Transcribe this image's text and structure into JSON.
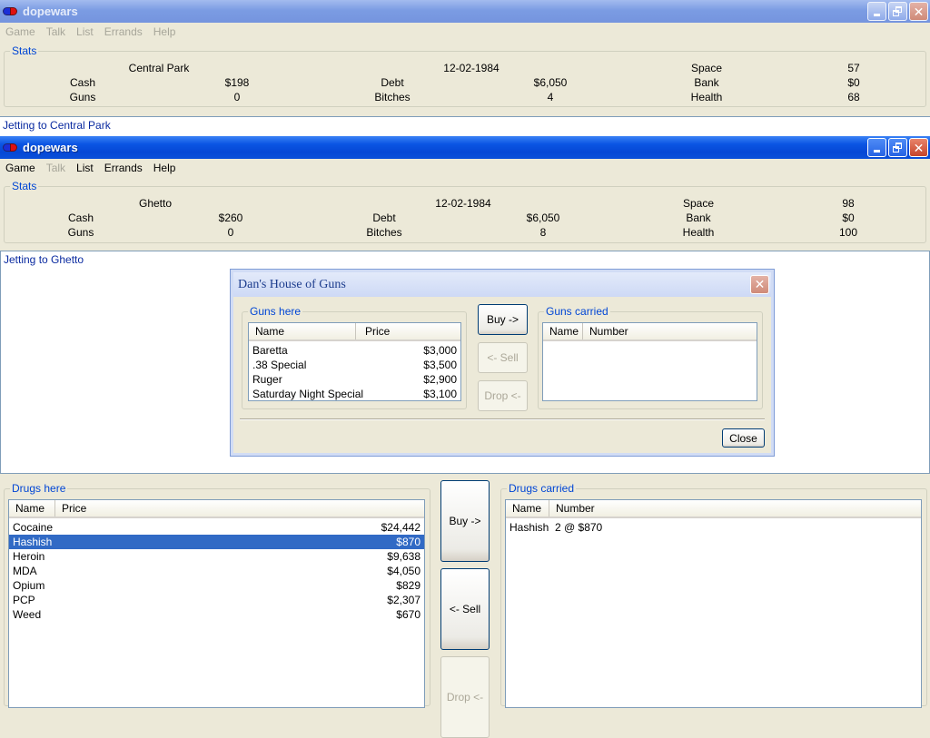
{
  "window1": {
    "title": "dopewars",
    "menu": [
      {
        "label": "Game",
        "enabled": false
      },
      {
        "label": "Talk",
        "enabled": false
      },
      {
        "label": "List",
        "enabled": false
      },
      {
        "label": "Errands",
        "enabled": false
      },
      {
        "label": "Help",
        "enabled": false
      }
    ],
    "stats_legend": "Stats",
    "stats": {
      "location": "Central Park",
      "date": "12-02-1984",
      "space_label": "Space",
      "space": "57",
      "cash_label": "Cash",
      "cash": "$198",
      "debt_label": "Debt",
      "debt": "$6,050",
      "bank_label": "Bank",
      "bank": "$0",
      "guns_label": "Guns",
      "guns": "0",
      "bitches_label": "Bitches",
      "bitches": "4",
      "health_label": "Health",
      "health": "68"
    },
    "message": "Jetting to Central Park"
  },
  "window2": {
    "title": "dopewars",
    "menu": [
      {
        "label": "Game",
        "enabled": true
      },
      {
        "label": "Talk",
        "enabled": false
      },
      {
        "label": "List",
        "enabled": true
      },
      {
        "label": "Errands",
        "enabled": true
      },
      {
        "label": "Help",
        "enabled": true
      }
    ],
    "stats_legend": "Stats",
    "stats": {
      "location": "Ghetto",
      "date": "12-02-1984",
      "space_label": "Space",
      "space": "98",
      "cash_label": "Cash",
      "cash": "$260",
      "debt_label": "Debt",
      "debt": "$6,050",
      "bank_label": "Bank",
      "bank": "$0",
      "guns_label": "Guns",
      "guns": "0",
      "bitches_label": "Bitches",
      "bitches": "8",
      "health_label": "Health",
      "health": "100"
    },
    "message": "Jetting to Ghetto",
    "drugs_here": {
      "legend": "Drugs here",
      "col_name": "Name",
      "col_price": "Price",
      "rows": [
        {
          "name": "Cocaine",
          "price": "$24,442"
        },
        {
          "name": "Hashish",
          "price": "$870",
          "selected": true
        },
        {
          "name": "Heroin",
          "price": "$9,638"
        },
        {
          "name": "MDA",
          "price": "$4,050"
        },
        {
          "name": "Opium",
          "price": "$829"
        },
        {
          "name": "PCP",
          "price": "$2,307"
        },
        {
          "name": "Weed",
          "price": "$670"
        }
      ]
    },
    "buttons": {
      "buy": "Buy ->",
      "sell": "<- Sell",
      "drop": "Drop <-"
    },
    "drugs_carried": {
      "legend": "Drugs carried",
      "col_name": "Name",
      "col_number": "Number",
      "rows": [
        {
          "name": "Hashish",
          "number": "2 @ $870"
        }
      ]
    }
  },
  "dialog": {
    "title": "Dan's House of Guns",
    "guns_here": {
      "legend": "Guns here",
      "col_name": "Name",
      "col_price": "Price",
      "rows": [
        {
          "name": "Baretta",
          "price": "$3,000"
        },
        {
          "name": ".38 Special",
          "price": "$3,500"
        },
        {
          "name": "Ruger",
          "price": "$2,900"
        },
        {
          "name": "Saturday Night Special",
          "price": "$3,100"
        }
      ]
    },
    "buttons": {
      "buy": "Buy ->",
      "sell": "<- Sell",
      "drop": "Drop <-",
      "close": "Close"
    },
    "guns_carried": {
      "legend": "Guns carried",
      "col_name": "Name",
      "col_number": "Number",
      "rows": []
    }
  }
}
